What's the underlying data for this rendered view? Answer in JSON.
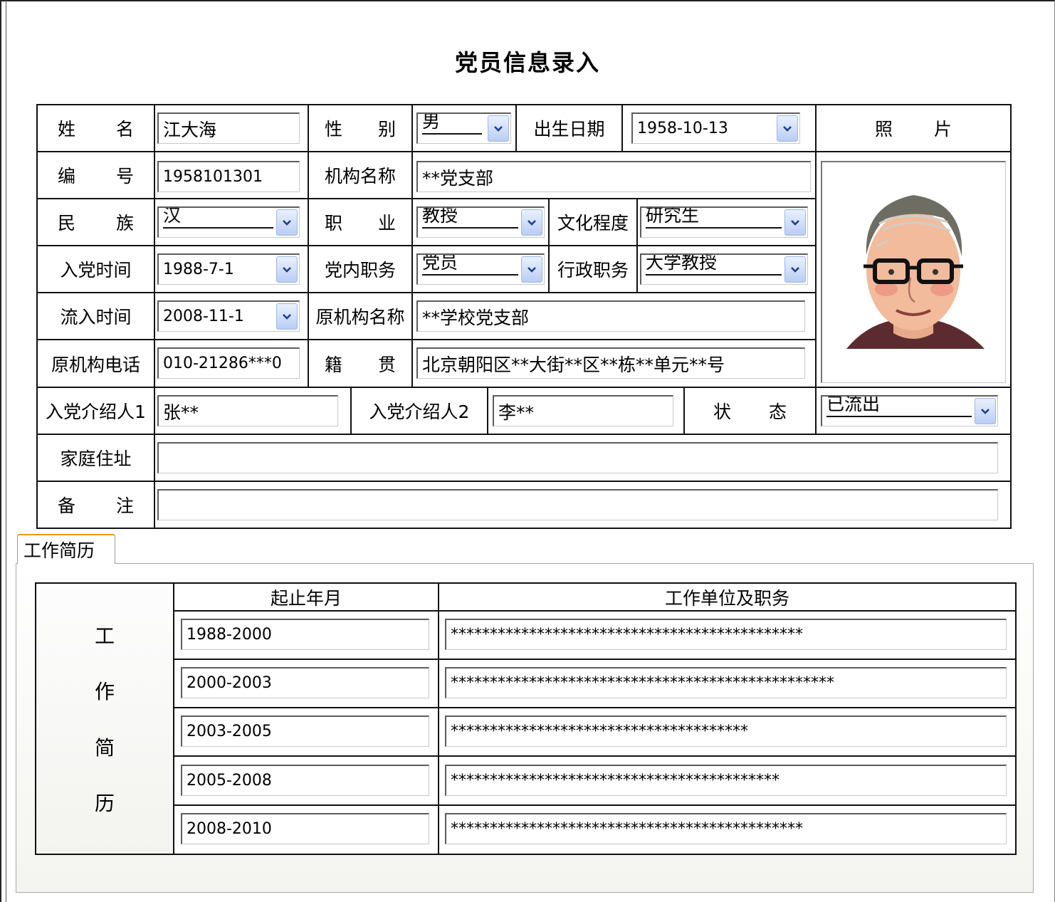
{
  "title": "党员信息录入",
  "labels": {
    "name": "姓 名",
    "gender": "性 别",
    "birth": "出生日期",
    "photo": "照 片",
    "number": "编 号",
    "org_name": "机构名称",
    "ethnic": "民 族",
    "occupation": "职 业",
    "education": "文化程度",
    "join_date": "入党时间",
    "party_duty": "党内职务",
    "admin_duty": "行政职务",
    "inflow_date": "流入时间",
    "orig_org": "原机构名称",
    "orig_phone": "原机构电话",
    "native": "籍 贯",
    "introducer1": "入党介绍人1",
    "introducer2": "入党介绍人2",
    "status": "状 态",
    "home_address": "家庭住址",
    "remark": "备 注"
  },
  "values": {
    "name": "江大海",
    "gender": "男",
    "birth": "1958-10-13",
    "number": "1958101301",
    "org_name": "**党支部",
    "ethnic": "汉",
    "occupation": "教授",
    "education": "研究生",
    "join_date": "1988-7-1",
    "party_duty": "党员",
    "admin_duty": "大学教授",
    "inflow_date": "2008-11-1",
    "orig_org": "**学校党支部",
    "orig_phone": "010-21286***0",
    "native": "北京朝阳区**大街**区**栋**单元**号",
    "introducer1": "张**",
    "introducer2": "李**",
    "status": "已流出",
    "home_address": "",
    "remark": ""
  },
  "tab": {
    "label": "工作简历"
  },
  "history": {
    "side_label": [
      "工",
      "作",
      "简",
      "历"
    ],
    "col_period": "起止年月",
    "col_unit": "工作单位及职务",
    "rows": [
      {
        "period": "1988-2000",
        "unit": "*********************************************"
      },
      {
        "period": "2000-2003",
        "unit": "*************************************************"
      },
      {
        "period": "2003-2005",
        "unit": "**************************************"
      },
      {
        "period": "2005-2008",
        "unit": "******************************************"
      },
      {
        "period": "2008-2010",
        "unit": "*********************************************"
      }
    ]
  },
  "icons": {
    "dropdown": "chevron-down-icon",
    "photo": "person-portrait-icon"
  },
  "colors": {
    "tab_accent": "#e59a1c",
    "dropdown_btn": "#b9cdf4"
  }
}
